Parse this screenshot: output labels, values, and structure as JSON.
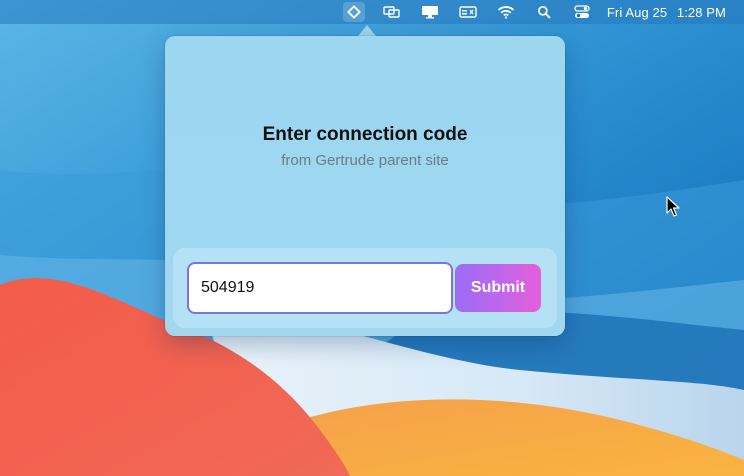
{
  "menubar": {
    "icons": [
      "connection-app-icon",
      "display-mirroring-icon",
      "airplay-display-icon",
      "keyboard-input-icon",
      "wifi-icon",
      "spotlight-search-icon",
      "control-center-icon"
    ],
    "date": "Fri Aug 25",
    "time": "1:28 PM"
  },
  "popover": {
    "title": "Enter connection code",
    "subtitle": "from Gertrude parent site",
    "code_input": {
      "value": "504919",
      "placeholder": ""
    },
    "submit_label": "Submit"
  },
  "colors": {
    "input_border": "#7b74e4",
    "submit_gradient_start": "#9b6cf3",
    "submit_gradient_end": "#e55fd9",
    "popover_background": "#9cd6ef"
  }
}
